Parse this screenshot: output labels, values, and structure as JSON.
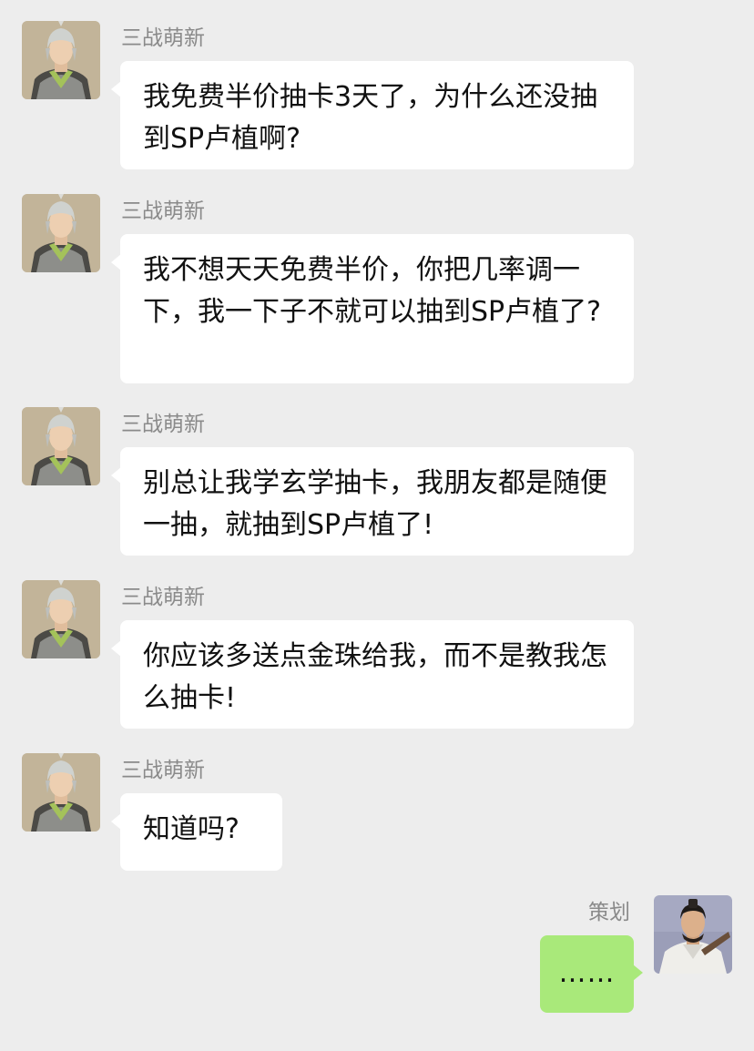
{
  "incoming": [
    {
      "sender": "三战萌新",
      "text": "我免费半价抽卡3天了，为什么还没抽到SP卢植啊?",
      "avatar": "general-avatar-icon"
    },
    {
      "sender": "三战萌新",
      "text": "我不想天天免费半价，你把几率调一下，我一下子不就可以抽到SP卢植了?",
      "avatar": "general-avatar-icon"
    },
    {
      "sender": "三战萌新",
      "text": "别总让我学玄学抽卡，我朋友都是随便一抽，就抽到SP卢植了!",
      "avatar": "general-avatar-icon"
    },
    {
      "sender": "三战萌新",
      "text": "你应该多送点金珠给我，而不是教我怎么抽卡!",
      "avatar": "general-avatar-icon"
    },
    {
      "sender": "三战萌新",
      "text": "知道吗?",
      "avatar": "general-avatar-icon"
    }
  ],
  "outgoing": {
    "sender": "策划",
    "text": "……",
    "avatar": "scholar-avatar-icon"
  },
  "colors": {
    "background": "#ededed",
    "incoming_bubble": "#ffffff",
    "outgoing_bubble": "#a9e97a",
    "sender_name": "#8a8a8a",
    "message_text": "#111111"
  }
}
